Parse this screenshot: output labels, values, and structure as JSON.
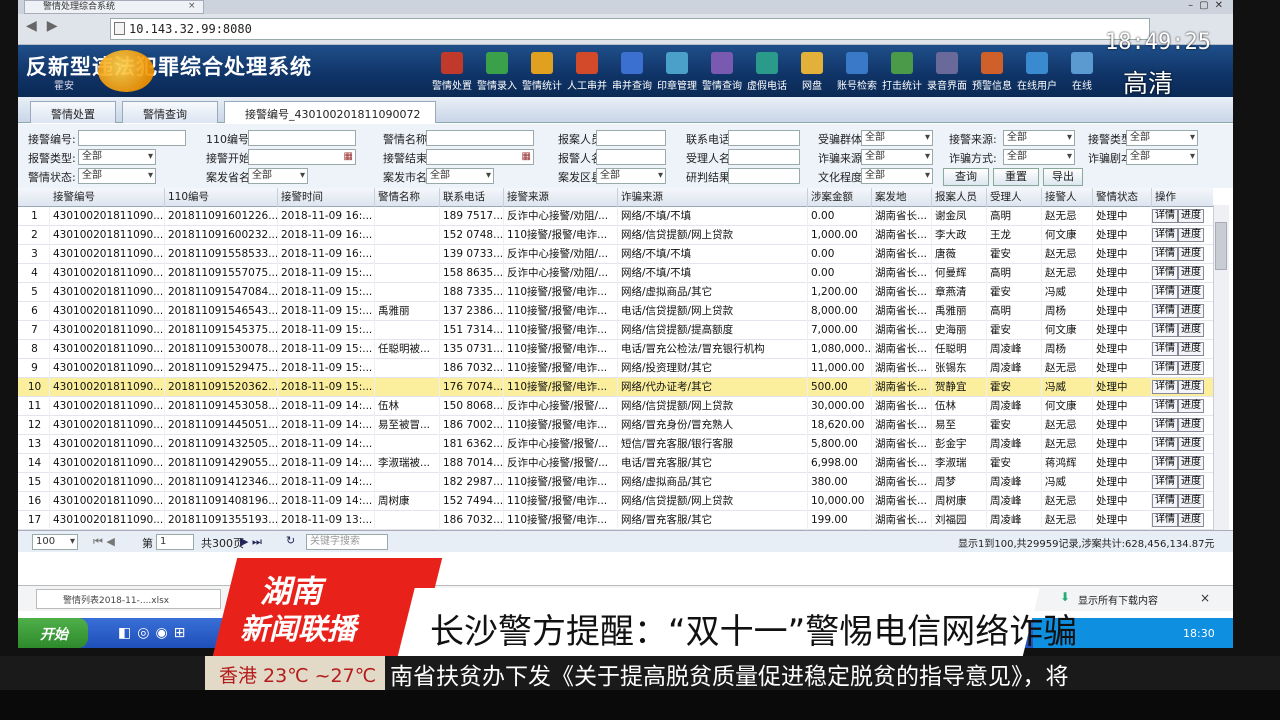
{
  "browser": {
    "tab_title": "警情处理综合系统",
    "url": "10.143.32.99:8080"
  },
  "app": {
    "title": "反新型违法犯罪综合处理系统",
    "user": "霍安"
  },
  "toolbar": [
    "警情处置",
    "警情录入",
    "警情统计",
    "人工串并",
    "串并查询",
    "印章管理",
    "警情查询",
    "虚假电话",
    "网盘",
    "账号检索",
    "打击统计",
    "录音界面",
    "预警信息",
    "在线用户",
    "在线"
  ],
  "overlay": {
    "clock": "18:49:25",
    "hd": "高清"
  },
  "tabs": [
    {
      "label": "警情处置"
    },
    {
      "label": "警情查询"
    },
    {
      "label": "接警编号_430100201811090072"
    }
  ],
  "filters": {
    "labels": [
      "接警编号:",
      "110编号:",
      "警情名称:",
      "报案人员:",
      "联系电话:",
      "受骗群体:",
      "接警来源:",
      "接警类型:",
      "报警类型:",
      "接警开始:",
      "接警结束:",
      "报警人名:",
      "受理人名:",
      "诈骗来源:",
      "诈骗方式:",
      "诈骗剧本:",
      "警情状态:",
      "案发省名:",
      "案发市名:",
      "案发区县:",
      "研判结果:",
      "文化程度:"
    ],
    "all": "全部",
    "buttons": {
      "query": "查询",
      "reset": "重置",
      "export": "导出"
    }
  },
  "grid": {
    "headers": [
      "接警编号",
      "110编号",
      "接警时间",
      "警情名称",
      "联系电话",
      "接警来源",
      "诈骗来源",
      "涉案金额",
      "案发地",
      "报案人员",
      "受理人",
      "接警人",
      "警情状态",
      "操作"
    ],
    "op_detail": "详情",
    "op_progress": "进度",
    "rows": [
      [
        "1",
        "430100201811090...",
        "201811091601226...",
        "2018-11-09 16:...",
        "",
        "189 7517...",
        "反诈中心接警/劝阻/...",
        "网络/不填/不填",
        "0.00",
        "湖南省长...",
        "谢金凤",
        "高明",
        "赵无忌",
        "处理中"
      ],
      [
        "2",
        "430100201811090...",
        "201811091600232...",
        "2018-11-09 16:...",
        "",
        "152 0748...",
        "110接警/报警/电诈...",
        "网络/信贷提额/网上贷款",
        "1,000.00",
        "湖南省长...",
        "李大政",
        "王龙",
        "何文康",
        "处理中"
      ],
      [
        "3",
        "430100201811090...",
        "201811091558533...",
        "2018-11-09 16:...",
        "",
        "139 0733...",
        "反诈中心接警/劝阻/...",
        "网络/不填/不填",
        "0.00",
        "湖南省长...",
        "唐薇",
        "霍安",
        "赵无忌",
        "处理中"
      ],
      [
        "4",
        "430100201811090...",
        "201811091557075...",
        "2018-11-09 15:...",
        "",
        "158 8635...",
        "反诈中心接警/劝阻/...",
        "网络/不填/不填",
        "0.00",
        "湖南省长...",
        "何曼辉",
        "高明",
        "赵无忌",
        "处理中"
      ],
      [
        "5",
        "430100201811090...",
        "201811091547084...",
        "2018-11-09 15:...",
        "",
        "188 7335...",
        "110接警/报警/电诈...",
        "网络/虚拟商品/其它",
        "1,200.00",
        "湖南省长...",
        "章燕清",
        "霍安",
        "冯威",
        "处理中"
      ],
      [
        "6",
        "430100201811090...",
        "201811091546543...",
        "2018-11-09 15:...",
        "禹雅丽",
        "137 2386...",
        "110接警/报警/电诈...",
        "电话/信贷提额/网上贷款",
        "8,000.00",
        "湖南省长...",
        "禹雅丽",
        "高明",
        "周杨",
        "处理中"
      ],
      [
        "7",
        "430100201811090...",
        "201811091545375...",
        "2018-11-09 15:...",
        "",
        "151 7314...",
        "110接警/报警/电诈...",
        "网络/信贷提额/提高额度",
        "7,000.00",
        "湖南省长...",
        "史海丽",
        "霍安",
        "何文康",
        "处理中"
      ],
      [
        "8",
        "430100201811090...",
        "201811091530078...",
        "2018-11-09 15:...",
        "任聪明被...",
        "135 0731...",
        "110接警/报警/电诈...",
        "电话/冒充公检法/冒充银行机构",
        "1,080,000...",
        "湖南省长...",
        "任聪明",
        "周凌峰",
        "周杨",
        "处理中"
      ],
      [
        "9",
        "430100201811090...",
        "201811091529475...",
        "2018-11-09 15:...",
        "",
        "186 7032...",
        "110接警/报警/电诈...",
        "网络/投资理财/其它",
        "11,000.00",
        "湖南省长...",
        "张锡东",
        "周凌峰",
        "赵无忌",
        "处理中"
      ],
      [
        "10",
        "430100201811090...",
        "201811091520362...",
        "2018-11-09 15:...",
        "",
        "176 7074...",
        "110接警/报警/电诈...",
        "网络/代办证考/其它",
        "500.00",
        "湖南省长...",
        "贺静宜",
        "霍安",
        "冯威",
        "处理中"
      ],
      [
        "11",
        "430100201811090...",
        "201811091453058...",
        "2018-11-09 14:...",
        "伍林",
        "150 8068...",
        "反诈中心接警/报警/...",
        "网络/信贷提额/网上贷款",
        "30,000.00",
        "湖南省长...",
        "伍林",
        "周凌峰",
        "何文康",
        "处理中"
      ],
      [
        "12",
        "430100201811090...",
        "201811091445051...",
        "2018-11-09 14:...",
        "易至被冒...",
        "186 7002...",
        "110接警/报警/电诈...",
        "网络/冒充身份/冒充熟人",
        "18,620.00",
        "湖南省长...",
        "易至",
        "霍安",
        "赵无忌",
        "处理中"
      ],
      [
        "13",
        "430100201811090...",
        "201811091432505...",
        "2018-11-09 14:...",
        "",
        "181 6362...",
        "反诈中心接警/报警/...",
        "短信/冒充客服/银行客服",
        "5,800.00",
        "湖南省长...",
        "彭金宇",
        "周凌峰",
        "赵无忌",
        "处理中"
      ],
      [
        "14",
        "430100201811090...",
        "201811091429055...",
        "2018-11-09 14:...",
        "李淑瑞被...",
        "188 7014...",
        "反诈中心接警/报警/...",
        "电话/冒充客服/其它",
        "6,998.00",
        "湖南省长...",
        "李淑瑞",
        "霍安",
        "蒋鸿辉",
        "处理中"
      ],
      [
        "15",
        "430100201811090...",
        "201811091412346...",
        "2018-11-09 14:...",
        "",
        "182 2987...",
        "110接警/报警/电诈...",
        "网络/虚拟商品/其它",
        "380.00",
        "湖南省长...",
        "周梦",
        "周凌峰",
        "冯威",
        "处理中"
      ],
      [
        "16",
        "430100201811090...",
        "201811091408196...",
        "2018-11-09 14:...",
        "周树康",
        "152 7494...",
        "110接警/报警/电诈...",
        "网络/信贷提额/网上贷款",
        "10,000.00",
        "湖南省长...",
        "周树康",
        "周凌峰",
        "赵无忌",
        "处理中"
      ],
      [
        "17",
        "430100201811090...",
        "201811091355193...",
        "2018-11-09 13:...",
        "",
        "186 7032...",
        "110接警/报警/电诈...",
        "网络/冒充客服/其它",
        "199.00",
        "湖南省长...",
        "刘福园",
        "周凌峰",
        "赵无忌",
        "处理中"
      ]
    ]
  },
  "pager": {
    "page_size": "100",
    "page_label": "第",
    "page": "1",
    "total_pages": "共300页",
    "search_placeholder": "关键字搜索",
    "summary": "显示1到100,共29959记录,涉案共计:628,456,134.87元"
  },
  "download": {
    "file": "警情列表2018-11-....xlsx",
    "show_all": "显示所有下载内容"
  },
  "taskbar": {
    "start": "开始",
    "time": "18:30"
  },
  "broadcast": {
    "station_line1": "湖南",
    "station_line2": "新闻联播",
    "headline": "长沙警方提醒：“双十一”警惕电信网络诈骗",
    "weather": "香港 23℃ ~27℃",
    "ticker": "南省扶贫办下发《关于提高脱贫质量促进稳定脱贫的指导意见》，将"
  }
}
